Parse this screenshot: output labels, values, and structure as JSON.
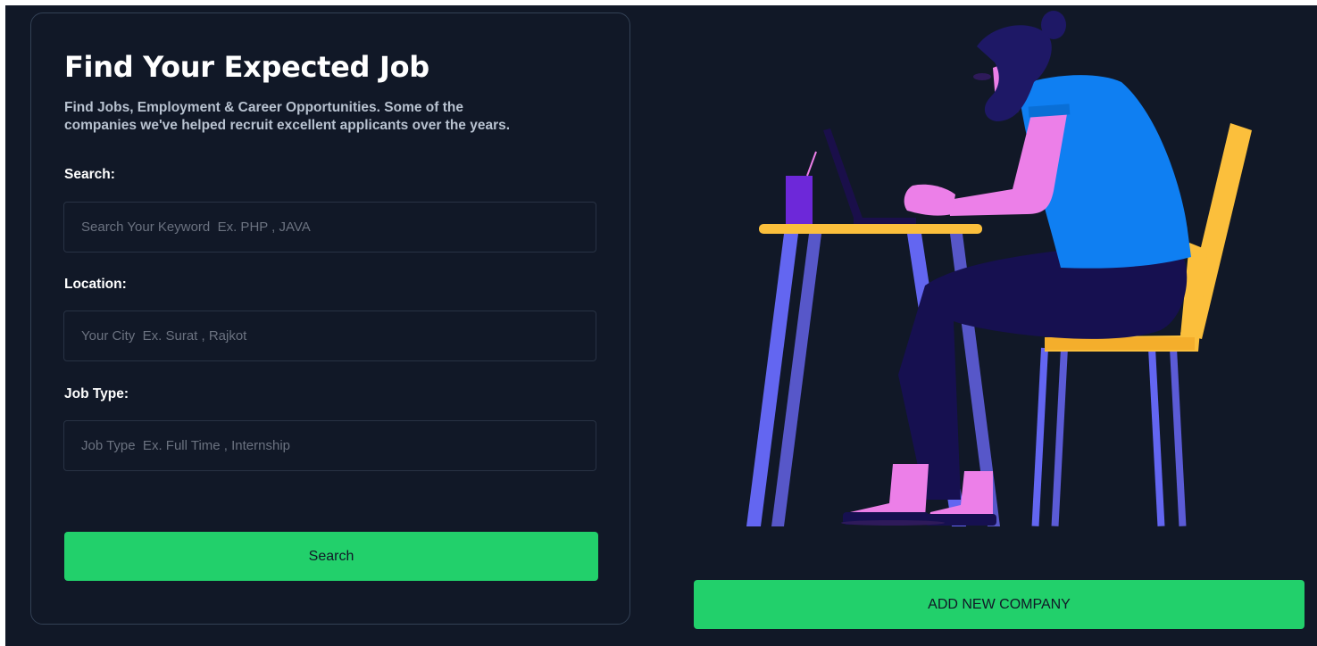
{
  "hero": {
    "title": "Find Your Expected Job",
    "subtitle_line1": "Find Jobs, Employment & Career Opportunities. Some of the",
    "subtitle_line2": "companies we've helped recruit excellent applicants over the years."
  },
  "form": {
    "search": {
      "label": "Search:",
      "placeholder": "Search Your Keyword  Ex. PHP , JAVA",
      "value": ""
    },
    "location": {
      "label": "Location:",
      "placeholder": "Your City  Ex. Surat , Rajkot",
      "value": ""
    },
    "job_type": {
      "label": "Job Type:",
      "placeholder": "Job Type  Ex. Full Time , Internship",
      "value": ""
    },
    "submit_label": "Search"
  },
  "actions": {
    "add_company_label": "ADD NEW COMPANY"
  },
  "illustration": {
    "icon": "person-working-on-laptop-illustration"
  },
  "colors": {
    "background": "#111827",
    "accent_green": "#22d06b",
    "card_border": "#334155",
    "shirt_blue": "#0f7ff2",
    "chair_yellow": "#fbbf3c",
    "leg_purple": "#6366f1",
    "skin_pink": "#ec7fe8",
    "pants_navy": "#161050"
  }
}
